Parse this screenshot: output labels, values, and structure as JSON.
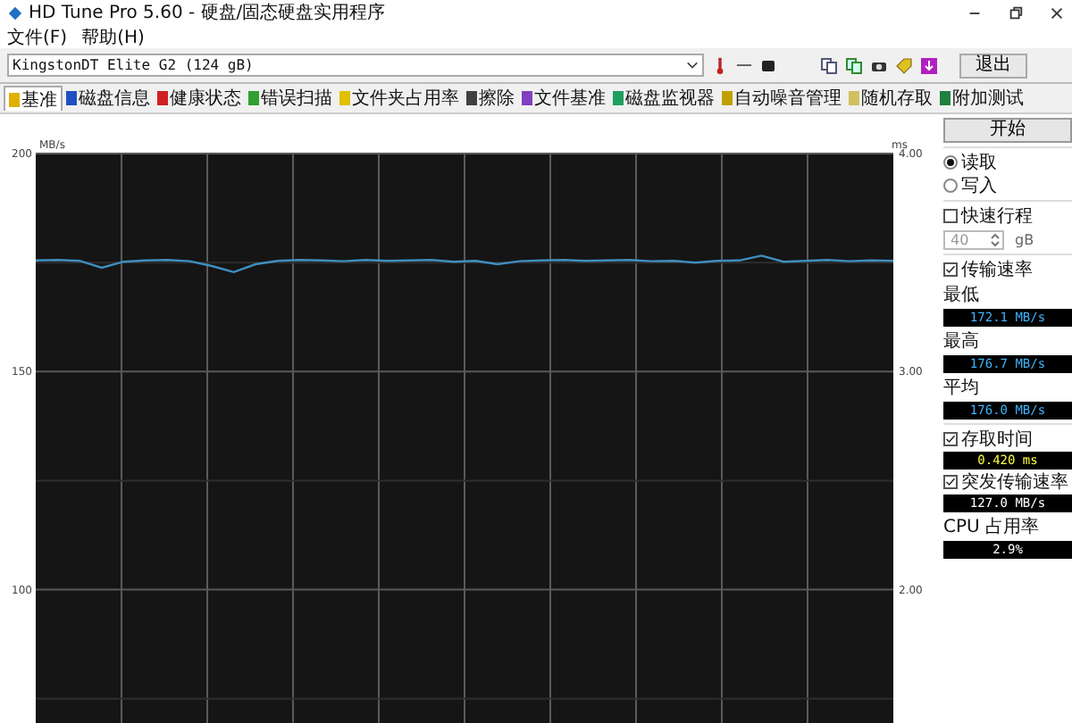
{
  "window": {
    "title": "HD Tune Pro 5.60 - 硬盘/固态硬盘实用程序"
  },
  "menu": [
    "文件(F)",
    "帮助(H)"
  ],
  "toolbar": {
    "drive": "KingstonDT Elite G2 (124 gB)",
    "temperature": "—",
    "exit_button": "退出"
  },
  "tabs": [
    {
      "label": "基准",
      "selected": true
    },
    {
      "label": "磁盘信息",
      "selected": false
    },
    {
      "label": "健康状态",
      "selected": false
    },
    {
      "label": "错误扫描",
      "selected": false
    },
    {
      "label": "文件夹占用率",
      "selected": false
    },
    {
      "label": "擦除",
      "selected": false
    },
    {
      "label": "文件基准",
      "selected": false
    },
    {
      "label": "磁盘监视器",
      "selected": false
    },
    {
      "label": "自动噪音管理",
      "selected": false
    },
    {
      "label": "随机存取",
      "selected": false
    },
    {
      "label": "附加测试",
      "selected": false
    }
  ],
  "chart": {
    "right_unit": "ms",
    "right_ticks": [
      "4.00",
      "3.00",
      "2.00"
    ],
    "chart_data": {
      "type": "line",
      "grid": true,
      "ylabel": "MB/s",
      "ylim": [
        60,
        200
      ],
      "yticks": [
        200,
        150,
        100
      ],
      "series": [
        {
          "color": "#3f8fc0",
          "values": [
            175.5,
            175.6,
            175.4,
            173.8,
            175.2,
            175.5,
            175.6,
            175.3,
            174.2,
            172.8,
            174.6,
            175.4,
            175.6,
            175.5,
            175.3,
            175.6,
            175.4,
            175.5,
            175.6,
            175.2,
            175.4,
            174.6,
            175.3,
            175.5,
            175.6,
            175.4,
            175.5,
            175.6,
            175.3,
            175.4,
            175.0,
            175.4,
            175.5,
            176.6,
            175.2,
            175.4,
            175.6,
            175.3,
            175.5,
            175.4
          ]
        }
      ]
    }
  },
  "panel": {
    "start_button": "开始",
    "modes": [
      {
        "label": "读取",
        "selected": true
      },
      {
        "label": "写入",
        "selected": false
      }
    ],
    "short_stroke": {
      "label": "快速行程",
      "checked": false,
      "value": "40",
      "unit": "gB"
    },
    "transfer_rate": {
      "label": "传输速率",
      "checked": true
    },
    "stats": [
      {
        "label": "最低",
        "value": "172.1 MB/s"
      },
      {
        "label": "最高",
        "value": "176.7 MB/s"
      },
      {
        "label": "平均",
        "value": "176.0 MB/s"
      }
    ],
    "access_time": {
      "label": "存取时间",
      "checked": true,
      "value": "0.420 ms"
    },
    "burst_rate": {
      "label": "突发传输速率",
      "checked": true,
      "value": "127.0 MB/s"
    },
    "cpu": {
      "label": "CPU 占用率",
      "value": "2.9%"
    }
  }
}
